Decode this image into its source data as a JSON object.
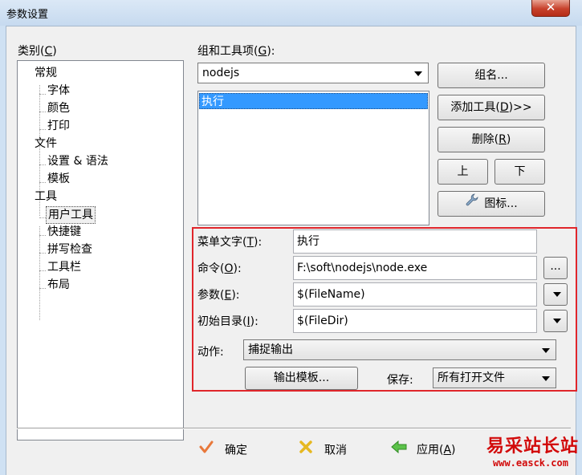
{
  "window": {
    "title": "参数设置",
    "close_glyph": "✕"
  },
  "category": {
    "label": "类别",
    "hotkey": "C",
    "items": [
      {
        "label": "常规"
      },
      {
        "label": "字体"
      },
      {
        "label": "颜色"
      },
      {
        "label": "打印"
      },
      {
        "label": "文件"
      },
      {
        "label": "设置 & 语法"
      },
      {
        "label": "模板"
      },
      {
        "label": "工具"
      },
      {
        "label": "用户工具"
      },
      {
        "label": "快捷键"
      },
      {
        "label": "拼写检查"
      },
      {
        "label": "工具栏"
      },
      {
        "label": "布局"
      }
    ]
  },
  "group": {
    "label": "组和工具项",
    "hotkey": "G",
    "selected": "nodejs",
    "list_items": [
      "执行"
    ]
  },
  "buttons": {
    "group_name": "组名...",
    "add_tool_pre": "添加工具(",
    "add_tool_key": "D",
    "add_tool_post": ")>>",
    "delete_pre": "删除(",
    "delete_key": "R",
    "delete_post": ")",
    "up": "上",
    "down": "下",
    "icon": "图标...",
    "browse": "...",
    "output_template": "输出模板..."
  },
  "form": {
    "menu_text": {
      "label": "菜单文字",
      "key": "T",
      "value": "执行"
    },
    "command": {
      "label": "命令",
      "key": "O",
      "value": "F:\\soft\\nodejs\\node.exe"
    },
    "params": {
      "label": "参数",
      "key": "E",
      "value": "$(FileName)"
    },
    "init_dir": {
      "label": "初始目录",
      "key": "I",
      "value": "$(FileDir)"
    },
    "action": {
      "label": "动作:",
      "value": "捕捉输出"
    },
    "save": {
      "label": "保存:",
      "value": "所有打开文件"
    }
  },
  "footer": {
    "ok": "确定",
    "cancel": "取消",
    "apply_pre": "应用(",
    "apply_key": "A",
    "apply_post": ")"
  },
  "watermark": {
    "text": "易采站长站",
    "url": "www.easck.com"
  },
  "colors": {
    "highlight": "#3399ff",
    "annotation_border": "#e0262b",
    "watermark": "#d20a0a"
  }
}
